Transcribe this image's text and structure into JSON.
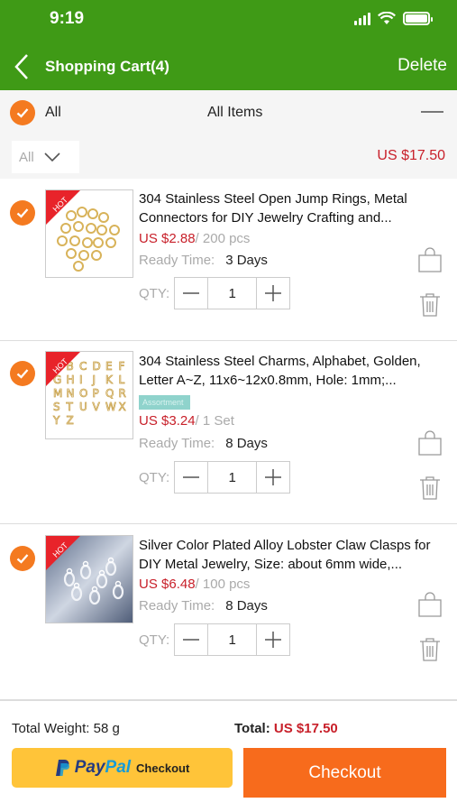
{
  "status_bar": {
    "time": "9:19"
  },
  "nav": {
    "title": "Shopping Cart(4)",
    "delete_label": "Delete"
  },
  "select_bar": {
    "all_label": "All",
    "all_items_label": "All Items"
  },
  "filter": {
    "selected": "All",
    "total": "US $17.50"
  },
  "items": [
    {
      "title": "304 Stainless Steel Open Jump Rings, Metal Connectors for DIY Jewelry Crafting and...",
      "badge": "HOT",
      "price": "US $2.88",
      "unit": "/ 200 pcs",
      "ready_label": "Ready Time:",
      "ready_value": "3 Days",
      "qty_label": "QTY:",
      "qty": "1"
    },
    {
      "title": "304 Stainless Steel Charms, Alphabet, Golden, Letter A~Z, 11x6~12x0.8mm, Hole: 1mm;...",
      "badge": "HOT",
      "variant_tag": "Assortment",
      "price": "US $3.24",
      "unit": "/ 1 Set",
      "ready_label": "Ready Time:",
      "ready_value": "8 Days",
      "qty_label": "QTY:",
      "qty": "1",
      "letters": "ABCDEFGHIJKLMNOPQRSTUVWXYZ"
    },
    {
      "title": "Silver Color Plated Alloy Lobster Claw Clasps for DIY Metal Jewelry, Size: about 6mm wide,...",
      "badge": "HOT",
      "price": "US $6.48",
      "unit": "/ 100 pcs",
      "ready_label": "Ready Time:",
      "ready_value": "8 Days",
      "qty_label": "QTY:",
      "qty": "1"
    }
  ],
  "footer": {
    "weight_label": "Total Weight: 58 g",
    "total_label": "Total:",
    "total_value": "US $17.50",
    "paypal_pay": "Pay",
    "paypal_pal": "Pal",
    "paypal_checkout": "Checkout",
    "checkout_label": "Checkout"
  },
  "colors": {
    "header": "#3f9a16",
    "accent": "#f47a20",
    "price": "#c8202a",
    "paypal": "#ffc439",
    "checkout": "#f76b1c"
  }
}
